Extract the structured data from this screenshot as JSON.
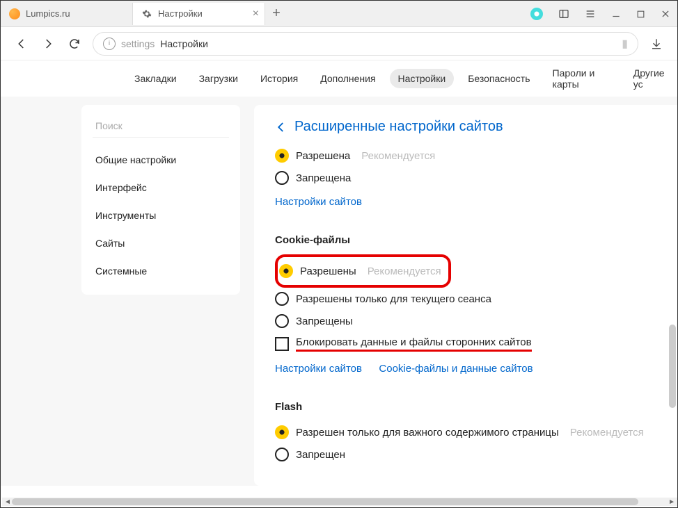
{
  "tabs": [
    {
      "label": "Lumpics.ru",
      "icon": "orange"
    },
    {
      "label": "Настройки",
      "icon": "gear",
      "active": true
    }
  ],
  "address": {
    "prefix": "settings",
    "title": "Настройки"
  },
  "topnav": [
    "Закладки",
    "Загрузки",
    "История",
    "Дополнения",
    "Настройки",
    "Безопасность",
    "Пароли и карты",
    "Другие ус"
  ],
  "topnav_active": 4,
  "sidebar": {
    "search_placeholder": "Поиск",
    "items": [
      "Общие настройки",
      "Интерфейс",
      "Инструменты",
      "Сайты",
      "Системные"
    ]
  },
  "main": {
    "title": "Расширенные настройки сайтов",
    "section1": {
      "opt1": {
        "label": "Разрешена",
        "hint": "Рекомендуется"
      },
      "opt2": {
        "label": "Запрещена"
      },
      "link": "Настройки сайтов"
    },
    "cookies": {
      "title": "Cookie-файлы",
      "opt1": {
        "label": "Разрешены",
        "hint": "Рекомендуется"
      },
      "opt2": {
        "label": "Разрешены только для текущего сеанса"
      },
      "opt3": {
        "label": "Запрещены"
      },
      "chk": {
        "label": "Блокировать данные и файлы сторонних сайтов"
      },
      "link1": "Настройки сайтов",
      "link2": "Cookie-файлы и данные сайтов"
    },
    "flash": {
      "title": "Flash",
      "opt1": {
        "label": "Разрешен только для важного содержимого страницы",
        "hint": "Рекомендуется"
      },
      "opt2": {
        "label": "Запрещен"
      }
    }
  }
}
